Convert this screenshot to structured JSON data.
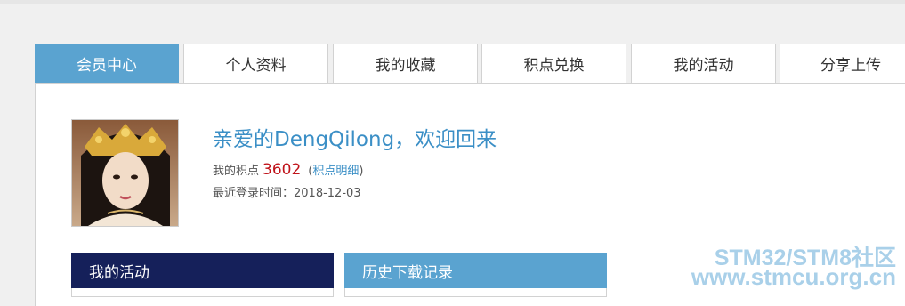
{
  "tabs": [
    {
      "label": "会员中心",
      "active": true
    },
    {
      "label": "个人资料",
      "active": false
    },
    {
      "label": "我的收藏",
      "active": false
    },
    {
      "label": "积点兑换",
      "active": false
    },
    {
      "label": "我的活动",
      "active": false
    },
    {
      "label": "分享上传",
      "active": false
    }
  ],
  "profile": {
    "welcome_text": "亲爱的DengQilong，欢迎回来",
    "points_label": "我的积点",
    "points_value": "3602",
    "paren_open": "(",
    "points_detail_link": "积点明细",
    "paren_close": ")",
    "last_login": "最近登录时间：2018-12-03"
  },
  "boxes": {
    "my_activity": {
      "title": "我的活动",
      "header_color": "#15205a"
    },
    "download_history": {
      "title": "历史下载记录",
      "header_color": "#5aa3d0"
    }
  },
  "watermark": {
    "line1": "STM32/STM8社区",
    "line2": "www.stmcu.org.cn"
  },
  "colors": {
    "accent": "#5aa3d0",
    "link": "#3b8fc6",
    "points": "#c0141b"
  }
}
